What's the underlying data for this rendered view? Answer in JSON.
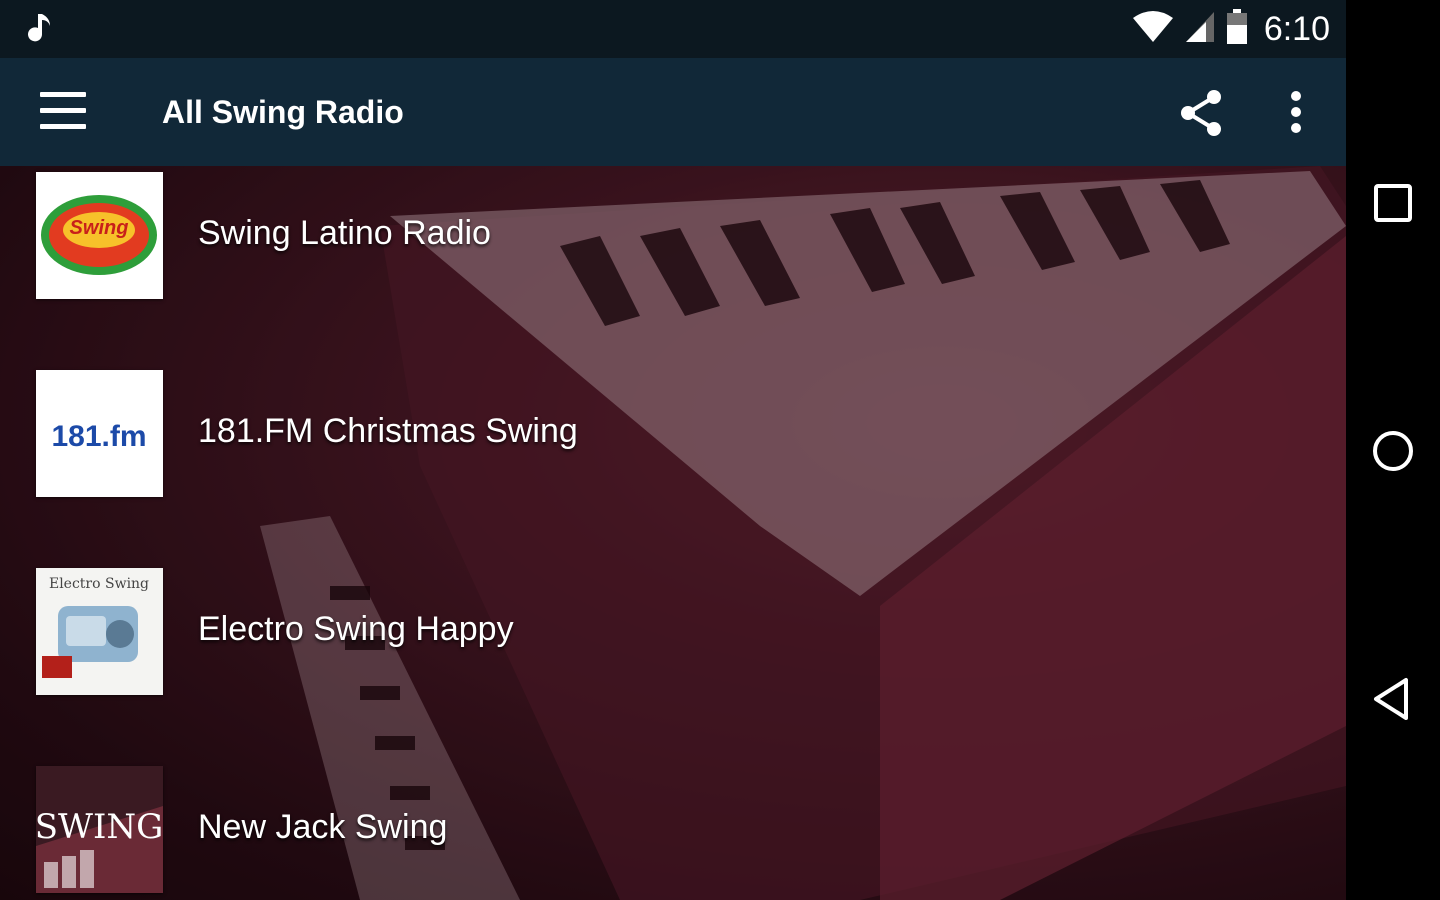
{
  "status_bar": {
    "time": "6:10",
    "icons": [
      "music-note-icon",
      "wifi-icon",
      "cell-signal-icon",
      "battery-icon"
    ]
  },
  "app_bar": {
    "title": "All Swing Radio",
    "icons": [
      "menu-icon",
      "share-icon",
      "more-vert-icon"
    ]
  },
  "stations": [
    {
      "name": "Swing Latino Radio",
      "logo": "Swing"
    },
    {
      "name": "181.FM Christmas Swing",
      "logo": "181.fm"
    },
    {
      "name": "Electro Swing Happy",
      "logo": "Electro Swing"
    },
    {
      "name": "New Jack Swing",
      "logo": "SWING"
    }
  ],
  "nav_bar": {
    "icons": [
      "recents-icon",
      "home-icon",
      "back-icon"
    ]
  },
  "colors": {
    "status_bar": "#0c1820",
    "app_bar": "#112838",
    "background_tint": "#6a2a36"
  }
}
